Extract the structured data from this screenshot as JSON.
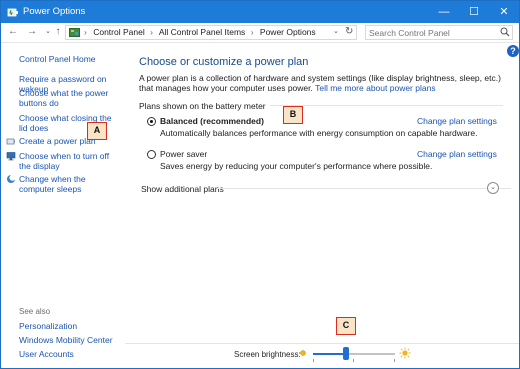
{
  "window": {
    "title": "Power Options",
    "controls": {
      "minimize": "—",
      "maximize": "☐",
      "close": "✕"
    }
  },
  "navigation": {
    "back": "←",
    "forward": "→",
    "recent": "⌄",
    "up": "↑",
    "breadcrumb": [
      "Control Panel",
      "All Control Panel Items",
      "Power Options"
    ],
    "separator": "›",
    "dropdown": "⌄",
    "refresh": "↻",
    "search_placeholder": "Search Control Panel"
  },
  "help": "?",
  "sidebar": {
    "home": "Control Panel Home",
    "links": [
      "Require a password on wakeup",
      "Choose what the power buttons do",
      "Choose what closing the lid does",
      "Create a power plan",
      "Choose when to turn off the display",
      "Change when the computer sleeps"
    ],
    "see_also_title": "See also",
    "see_also": [
      "Personalization",
      "Windows Mobility Center",
      "User Accounts"
    ]
  },
  "main": {
    "heading": "Choose or customize a power plan",
    "description": "A power plan is a collection of hardware and system settings (like display brightness, sleep, etc.) that manages how your computer uses power.",
    "learn_more": "Tell me more about power plans",
    "group_title": "Plans shown on the battery meter",
    "plans": [
      {
        "name": "Balanced (recommended)",
        "selected": true,
        "description": "Automatically balances performance with energy consumption on capable hardware.",
        "link": "Change plan settings"
      },
      {
        "name": "Power saver",
        "selected": false,
        "description": "Saves energy by reducing your computer's performance where possible.",
        "link": "Change plan settings"
      }
    ],
    "show_additional": "Show additional plans",
    "expander": "⌄"
  },
  "brightness": {
    "label": "Screen brightness:",
    "level_percent": 40
  },
  "callouts": {
    "a": "A",
    "b": "B",
    "c": "C"
  },
  "colors": {
    "titlebar": "#1e7bd7",
    "link": "#1a55b2",
    "heading": "#1a4a8e",
    "callout_border": "#d92e1e",
    "callout_fill": "#f9e4c8"
  }
}
